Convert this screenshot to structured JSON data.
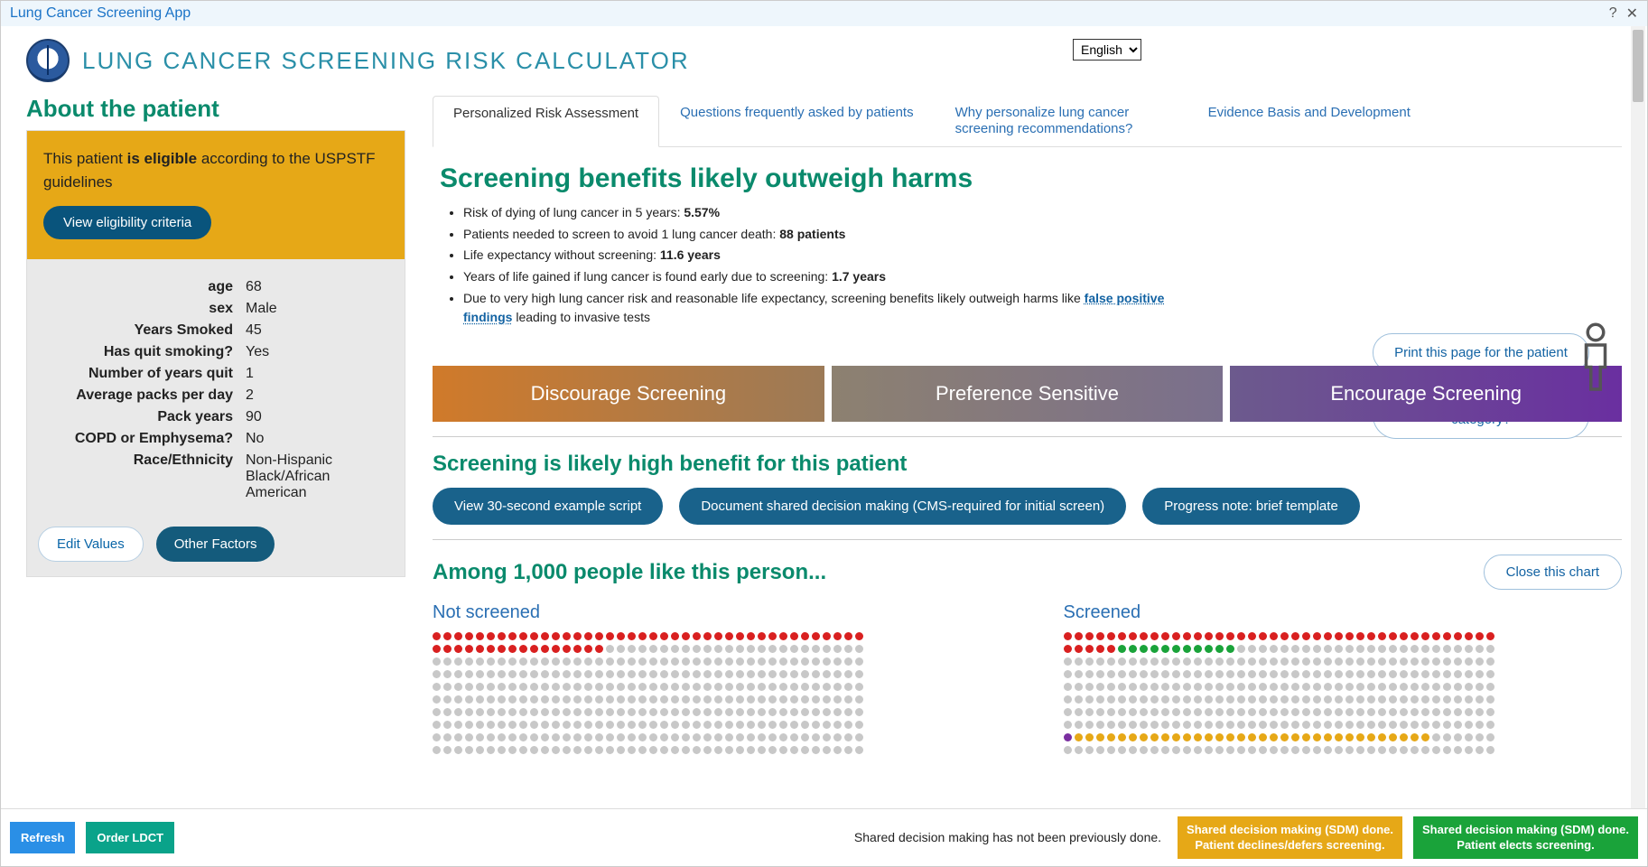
{
  "window": {
    "title": "Lung Cancer Screening App"
  },
  "app": {
    "title": "LUNG CANCER SCREENING RISK CALCULATOR"
  },
  "language": {
    "selected": "English"
  },
  "sidebar": {
    "heading": "About the patient",
    "eligibility_pre": "This patient ",
    "eligibility_bold": "is eligible",
    "eligibility_post": " according to the USPSTF guidelines",
    "view_criteria": "View eligibility criteria",
    "rows": [
      {
        "label": "age",
        "value": "68"
      },
      {
        "label": "sex",
        "value": "Male"
      },
      {
        "label": "Years Smoked",
        "value": "45"
      },
      {
        "label": "Has quit smoking?",
        "value": "Yes"
      },
      {
        "label": "Number of years quit",
        "value": "1"
      },
      {
        "label": "Average packs per day",
        "value": "2"
      },
      {
        "label": "Pack years",
        "value": "90"
      },
      {
        "label": "COPD or Emphysema?",
        "value": "No"
      },
      {
        "label": "Race/Ethnicity",
        "value": "Non-Hispanic Black/African American"
      }
    ],
    "edit_values": "Edit Values",
    "other_factors": "Other Factors"
  },
  "tabs": [
    "Personalized Risk Assessment",
    "Questions frequently asked by patients",
    "Why personalize lung cancer screening recommendations?",
    "Evidence Basis and Development"
  ],
  "assessment": {
    "headline": "Screening benefits likely outweigh harms",
    "bullets": {
      "b1_pre": "Risk of dying of lung cancer in 5 years: ",
      "b1_bold": "5.57%",
      "b2_pre": "Patients needed to screen to avoid 1 lung cancer death: ",
      "b2_bold": "88 patients",
      "b3_pre": "Life expectancy without screening: ",
      "b3_bold": "11.6 years",
      "b4_pre": "Years of life gained if lung cancer is found early due to screening: ",
      "b4_bold": "1.7 years",
      "b5_pre": "Due to very high lung cancer risk and reasonable life expectancy, screening benefits likely outweigh harms like ",
      "b5_link": "false positive findings",
      "b5_post": " leading to invasive tests"
    },
    "print_btn": "Print this page for the patient",
    "why_btn": "Why is my patient in this category?",
    "rec_segments": [
      "Discourage Screening",
      "Preference Sensitive",
      "Encourage Screening"
    ],
    "subheading": "Screening is likely high benefit for this patient",
    "actions": [
      "View 30-second example script",
      "Document shared decision making (CMS-required for initial screen)",
      "Progress note: brief template"
    ],
    "among_heading": "Among 1,000 people like this person...",
    "close_chart": "Close this chart",
    "col_labels": [
      "Not screened",
      "Screened"
    ]
  },
  "footer": {
    "refresh": "Refresh",
    "order": "Order LDCT",
    "note": "Shared decision making has not been previously done.",
    "sdm1_line1": "Shared decision making (SDM) done.",
    "sdm1_line2": "Patient declines/defers screening.",
    "sdm2_line1": "Shared decision making (SDM) done.",
    "sdm2_line2": "Patient elects screening."
  },
  "chart_data": {
    "type": "pictograph",
    "grid_cols": 40,
    "grid_rows": 10,
    "series": [
      {
        "name": "Not screened",
        "counts": {
          "red": 56,
          "grey": 344,
          "other": 0
        },
        "visible_rows": 10
      },
      {
        "name": "Screened",
        "counts": {
          "red": 45,
          "green": 11,
          "purple": 1,
          "orange": 33,
          "grey": 310
        },
        "visible_rows": 10
      }
    ],
    "note": "Each dot = 1 of 1,000 comparable patients; counts estimated from visible portion of pictograph."
  }
}
